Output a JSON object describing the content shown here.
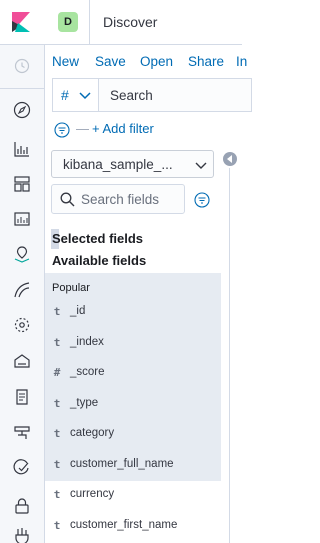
{
  "header": {
    "avatar_letter": "D",
    "app_title": "Discover"
  },
  "nav_rail": {
    "icons": [
      "kibana-logo-icon",
      "recently-viewed-icon",
      "discover-icon",
      "visualize-icon",
      "dashboard-icon",
      "canvas-icon",
      "maps-icon",
      "machine-learning-icon",
      "infrastructure-icon",
      "logs-icon",
      "apm-icon",
      "uptime-icon",
      "dev-tools-icon",
      "stack-monitoring-icon",
      "management-icon"
    ]
  },
  "top_menu": {
    "new_label": "New",
    "save_label": "Save",
    "open_label": "Open",
    "share_label": "Share",
    "more_label": "In"
  },
  "query_bar": {
    "language_symbol": "#",
    "placeholder": "Search"
  },
  "filter_bar": {
    "separator": "—",
    "add_filter_label": "+ Add filter"
  },
  "sidebar": {
    "index_pattern": "kibana_sample_...",
    "search_fields_placeholder": "Search fields",
    "selected_fields_title": "Selected fields",
    "available_fields_title": "Available fields",
    "popular_label": "Popular",
    "fields": [
      {
        "type": "t",
        "name": "_id"
      },
      {
        "type": "t",
        "name": "_index"
      },
      {
        "type": "#",
        "name": "_score"
      },
      {
        "type": "t",
        "name": "_type"
      },
      {
        "type": "t",
        "name": "category"
      },
      {
        "type": "t",
        "name": "customer_full_name"
      },
      {
        "type": "t",
        "name": "currency"
      },
      {
        "type": "t",
        "name": "customer_first_name"
      }
    ]
  },
  "colors": {
    "link": "#006bb4",
    "rail_bg": "#f5f7fa",
    "popular_bg": "#e6ebf2",
    "avatar_bg": "#a8e4a0"
  }
}
